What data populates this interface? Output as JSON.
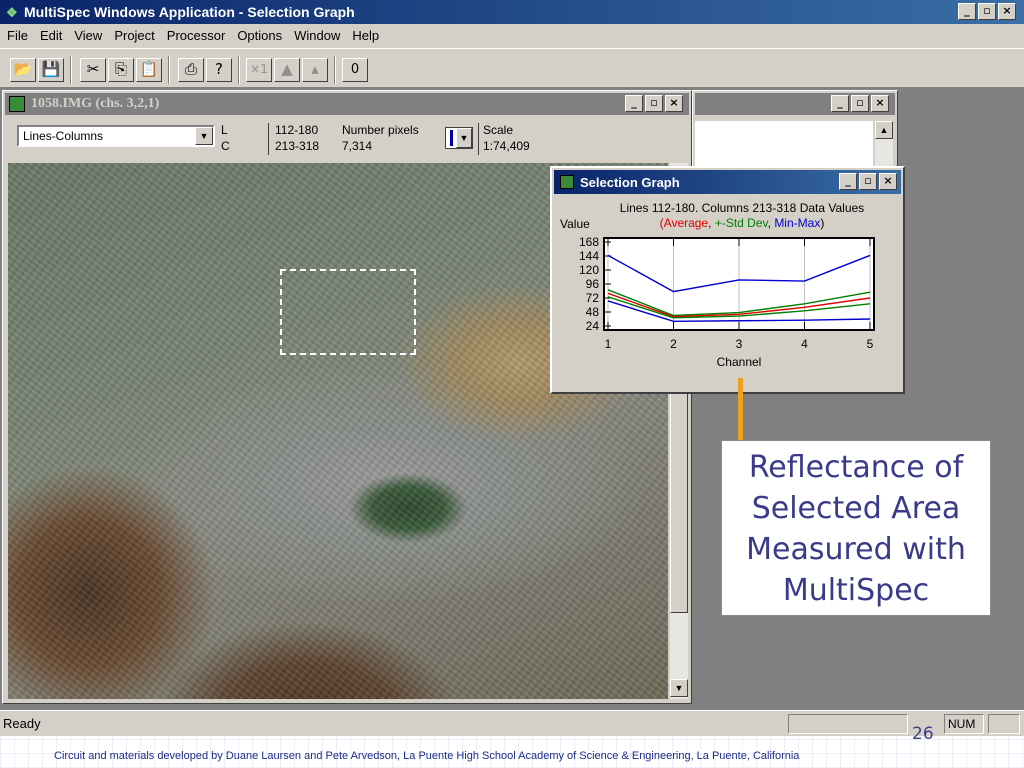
{
  "app": {
    "title": "MultiSpec Windows Application - Selection Graph",
    "window_controls": [
      "_",
      "▫",
      "×"
    ]
  },
  "menu": [
    "File",
    "Edit",
    "View",
    "Project",
    "Processor",
    "Options",
    "Window",
    "Help"
  ],
  "toolbar": {
    "buttons": [
      {
        "name": "open-icon",
        "glyph": "📂"
      },
      {
        "name": "save-icon",
        "glyph": "💾"
      },
      {
        "name": "cut-icon",
        "glyph": "✂"
      },
      {
        "name": "copy-icon",
        "glyph": "⎘"
      },
      {
        "name": "paste-icon",
        "glyph": "📋"
      },
      {
        "name": "print-icon",
        "glyph": "⎙"
      },
      {
        "name": "help-icon",
        "glyph": "?"
      },
      {
        "name": "zoom-x1-icon",
        "glyph": "×1"
      },
      {
        "name": "zoom-in-icon",
        "glyph": "▲"
      },
      {
        "name": "zoom-out-icon",
        "glyph": "▴"
      },
      {
        "name": "overlay-icon",
        "glyph": "0"
      }
    ]
  },
  "image_window": {
    "title": "1058.IMG (chs. 3,2,1)",
    "coord_mode": "Lines-Columns",
    "L_label": "L",
    "C_label": "C",
    "lines": "112-180",
    "columns": "213-318",
    "number_pixels_label": "Number pixels",
    "number_pixels": "7,314",
    "scale_label": "Scale",
    "scale": "1:74,409"
  },
  "selection_graph": {
    "title": "Selection Graph",
    "header": "Lines 112-180. Columns 213-318 Data Values",
    "legend_open": "(",
    "legend_close": ")",
    "legend": [
      {
        "label": "Average",
        "color": "#e00000"
      },
      {
        "label": "+-Std Dev",
        "color": "#008000"
      },
      {
        "label": "Min-Max",
        "color": "#0000d0"
      }
    ]
  },
  "chart_data": {
    "type": "line",
    "title": "Lines 112-180. Columns 213-318 Data Values",
    "xlabel": "Channel",
    "ylabel": "Value",
    "x": [
      1,
      2,
      3,
      4,
      5
    ],
    "ylim": [
      24,
      168
    ],
    "yticks": [
      24,
      48,
      72,
      96,
      120,
      144,
      168
    ],
    "xticks": [
      1,
      2,
      3,
      4,
      5
    ],
    "series": [
      {
        "name": "Min-Max",
        "color": "#0000d0",
        "values": [
          145,
          83,
          103,
          101,
          145
        ]
      },
      {
        "name": "+-Std Dev",
        "color": "#008000",
        "values": [
          86,
          42,
          47,
          62,
          82
        ]
      },
      {
        "name": "Average",
        "color": "#e00000",
        "values": [
          80,
          40,
          44,
          56,
          72
        ]
      },
      {
        "name": "+-Std Dev",
        "color": "#008000",
        "values": [
          74,
          38,
          41,
          50,
          62
        ]
      },
      {
        "name": "Min-Max",
        "color": "#0000d0",
        "values": [
          67,
          32,
          33,
          34,
          36
        ]
      }
    ]
  },
  "callout": {
    "lines": [
      "Reflectance of",
      "Selected Area",
      "Measured with",
      "MultiSpec"
    ],
    "line_color": "#f0a020"
  },
  "status": {
    "text": "Ready",
    "num": "NUM"
  },
  "footer": {
    "slide_number": "26",
    "credit": "Circuit and materials developed by Duane Laursen and Pete Arvedson, La Puente High School Academy of Science & Engineering, La Puente, California"
  }
}
